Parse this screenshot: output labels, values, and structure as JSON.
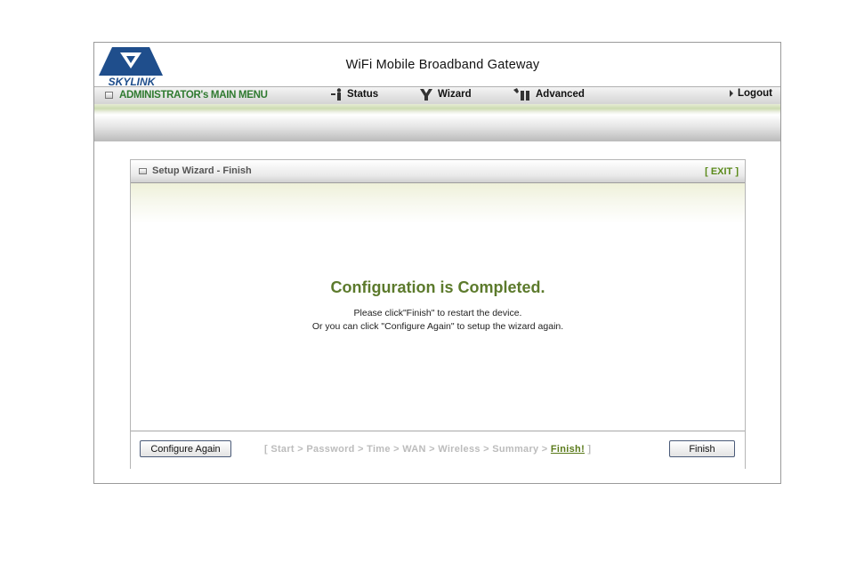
{
  "brand": {
    "logo_text": "SKYLINK",
    "logo_color": "#1f4e8c"
  },
  "header": {
    "title": "WiFi Mobile Broadband Gateway"
  },
  "menu": {
    "label": "ADMINISTRATOR's MAIN MENU",
    "items": [
      {
        "label": "Status",
        "icon": "status-icon"
      },
      {
        "label": "Wizard",
        "icon": "wizard-icon"
      },
      {
        "label": "Advanced",
        "icon": "advanced-icon"
      },
      {
        "label": "Logout",
        "icon": "arrow-right-icon"
      }
    ]
  },
  "panel": {
    "title": "Setup Wizard - Finish",
    "exit_label": "[ EXIT ]",
    "headline": "Configuration is Completed.",
    "line1": "Please click\"Finish\" to restart the device.",
    "line2": "Or you can click \"Configure Again\" to setup the wizard again."
  },
  "footer": {
    "configure_again_label": "Configure Again",
    "finish_label": "Finish",
    "steps_prefix": "[ Start > Password > Time > WAN > Wireless > Summary > ",
    "steps_active": "Finish!",
    "steps_suffix": " ]"
  },
  "colors": {
    "accent_green": "#5c7a2c",
    "menu_green": "#2f7a30",
    "button_border": "#4a5a78"
  }
}
